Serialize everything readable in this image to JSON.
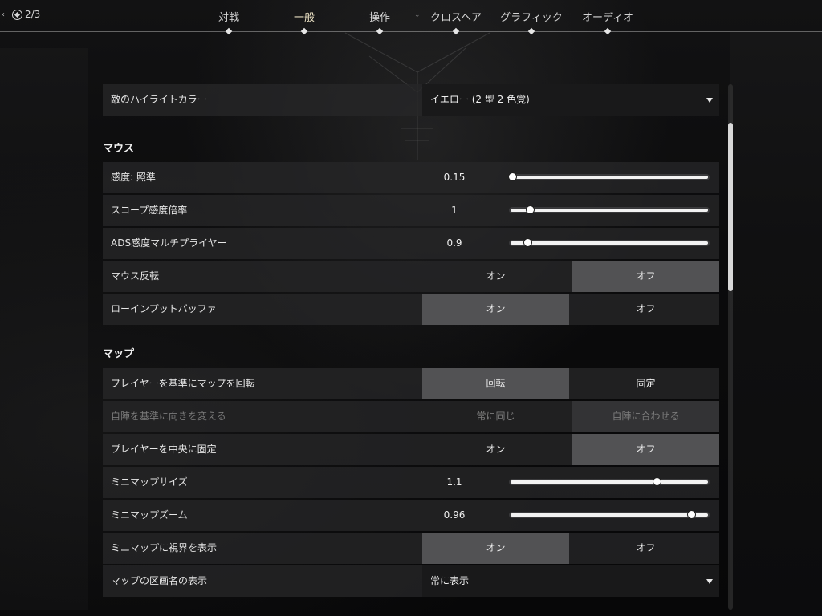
{
  "header": {
    "page_counter": "2/3",
    "tabs": [
      {
        "label": "対戦",
        "active": false
      },
      {
        "label": "一般",
        "active": true
      },
      {
        "label": "操作",
        "active": false
      },
      {
        "label": "クロスヘア",
        "active": false
      },
      {
        "label": "グラフィック",
        "active": false
      },
      {
        "label": "オーディオ",
        "active": false
      }
    ]
  },
  "settings": {
    "enemy_highlight": {
      "label": "敵のハイライトカラー",
      "value": "イエロー (2 型 2 色覚)"
    },
    "mouse": {
      "title": "マウス",
      "sensitivity_aim": {
        "label": "感度: 照準",
        "value": "0.15",
        "fraction": 0.0
      },
      "scoped_sensitivity": {
        "label": "スコープ感度倍率",
        "value": "1",
        "fraction": 0.09
      },
      "ads_multiplier": {
        "label": "ADS感度マルチプライヤー",
        "value": "0.9",
        "fraction": 0.08
      },
      "invert_mouse": {
        "label": "マウス反転",
        "on": "オン",
        "off": "オフ",
        "selected": "off"
      },
      "raw_input_buffer": {
        "label": "ローインプットバッファ",
        "on": "オン",
        "off": "オフ",
        "selected": "on"
      }
    },
    "map": {
      "title": "マップ",
      "rotate": {
        "label": "プレイヤーを基準にマップを回転",
        "left": "回転",
        "right": "固定",
        "selected": "left"
      },
      "orientation": {
        "label": "自陣を基準に向きを変える",
        "left": "常に同じ",
        "right": "自陣に合わせる",
        "selected": "right",
        "disabled": true
      },
      "center_player": {
        "label": "プレイヤーを中央に固定",
        "on": "オン",
        "off": "オフ",
        "selected": "off"
      },
      "minimap_size": {
        "label": "ミニマップサイズ",
        "value": "1.1",
        "fraction": 0.75
      },
      "minimap_zoom": {
        "label": "ミニマップズーム",
        "value": "0.96",
        "fraction": 0.93
      },
      "minimap_vision": {
        "label": "ミニマップに視界を表示",
        "on": "オン",
        "off": "オフ",
        "selected": "on"
      },
      "region_names": {
        "label": "マップの区画名の表示",
        "value": "常に表示"
      }
    }
  },
  "scroll": {
    "position_fraction": 0.3
  }
}
